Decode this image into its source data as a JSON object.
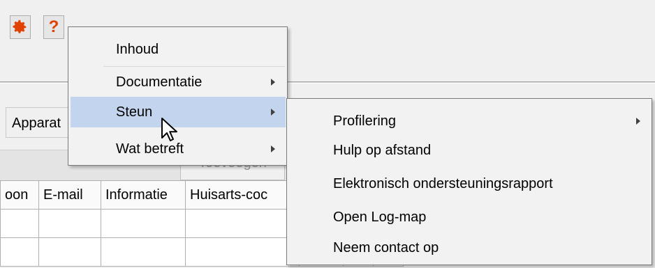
{
  "toolbar": {
    "gear_icon": "gear-icon",
    "help_label": "?",
    "colors": {
      "gear": "#e04000",
      "help": "#e04000"
    }
  },
  "tabs": {
    "apparatuur_partial": "Apparat"
  },
  "actions": {
    "add_label": "Toevoegen"
  },
  "table": {
    "columns": [
      "oon",
      "E-mail",
      "Informatie",
      "Huisarts-coc"
    ],
    "rows": [
      [
        "",
        "",
        "",
        ""
      ],
      [
        "",
        "",
        "",
        ""
      ]
    ]
  },
  "help_menu": {
    "items": [
      {
        "label": "Inhoud",
        "submenu": false
      },
      {
        "label": "Documentatie",
        "submenu": true
      },
      {
        "label": "Steun",
        "submenu": true,
        "highlighted": true
      },
      {
        "label": "Wat betreft",
        "submenu": true
      }
    ]
  },
  "support_submenu": {
    "items": [
      {
        "label": "Profilering",
        "submenu": true
      },
      {
        "label": "Hulp op afstand",
        "submenu": false
      },
      {
        "label": "Elektronisch ondersteuningsrapport",
        "submenu": false
      },
      {
        "label": "Open Log-map",
        "submenu": false
      },
      {
        "label": "Neem contact op",
        "submenu": false
      }
    ]
  },
  "colors": {
    "highlight": "#c3d5ee",
    "menu_bg": "#f2f2f2"
  }
}
